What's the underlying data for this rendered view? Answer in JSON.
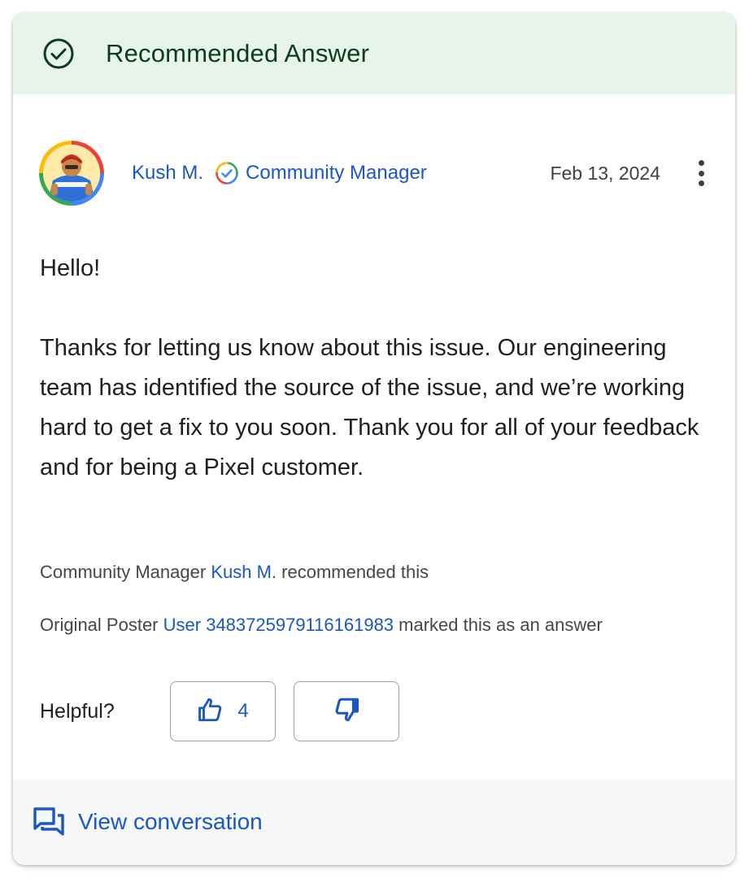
{
  "banner": {
    "icon": "check-circle-icon",
    "title": "Recommended Answer",
    "background": "#e6f4ea"
  },
  "author": {
    "avatar_icon": "avatar-illustration",
    "name": "Kush M.",
    "badge_icon": "verified-badge-icon",
    "role": "Community Manager",
    "date": "Feb 13, 2024",
    "menu_icon": "more-vert-icon"
  },
  "body": {
    "paragraphs": [
      "Hello!",
      "Thanks for letting us know about this issue. Our engineering team has identified the source of the issue, and we’re working hard to get a fix to you soon. Thank you for all of your feedback and for being a Pixel customer."
    ]
  },
  "recommendation": {
    "prefix": "Community Manager",
    "user": "Kush M.",
    "suffix": "recommended this"
  },
  "answer_mark": {
    "prefix": "Original Poster",
    "user": "User 3483725979116161983",
    "suffix": "marked this as an answer"
  },
  "helpful": {
    "label": "Helpful?",
    "up_icon": "thumb-up-icon",
    "up_count": "4",
    "down_icon": "thumb-down-icon"
  },
  "footer": {
    "icon": "forum-icon",
    "label": "View conversation"
  },
  "colors": {
    "link": "#1a56c4",
    "banner_text": "#0d3b1e",
    "text": "#1f1f1f"
  }
}
